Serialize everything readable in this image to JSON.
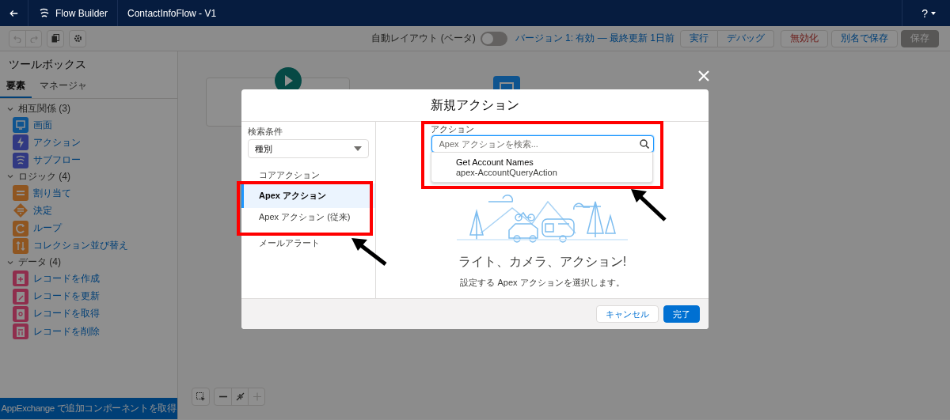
{
  "header": {
    "app_name": "Flow Builder",
    "flow_name": "ContactInfoFlow - V1",
    "help": "?"
  },
  "toolbar": {
    "auto_layout": {
      "label": "自動レイアウト (ベータ)",
      "on": false
    },
    "version": "バージョン 1: 有効 — 最終更新 1日前",
    "buttons": [
      {
        "label": "実行",
        "kind": "normal",
        "group": true,
        "disabled": false
      },
      {
        "label": "デバッグ",
        "kind": "normal",
        "group": true,
        "disabled": false
      },
      {
        "label": "無効化",
        "kind": "danger",
        "group": false,
        "disabled": false
      },
      {
        "label": "別名で保存",
        "kind": "normal",
        "group": false,
        "disabled": false
      },
      {
        "label": "保存",
        "kind": "normal",
        "group": false,
        "disabled": true
      }
    ]
  },
  "sidebar": {
    "title": "ツールボックス",
    "tabs": [
      {
        "label": "要素",
        "selected": true
      },
      {
        "label": "マネージャ",
        "selected": false
      }
    ],
    "sections": [
      {
        "label": "相互関係 (3)",
        "expanded": true,
        "items": [
          {
            "label": "画面",
            "kind": "screen"
          },
          {
            "label": "アクション",
            "kind": "action"
          },
          {
            "label": "サブフロー",
            "kind": "subflow"
          }
        ]
      },
      {
        "label": "ロジック (4)",
        "expanded": true,
        "items": [
          {
            "label": "割り当て",
            "kind": "assignment"
          },
          {
            "label": "決定",
            "kind": "decision"
          },
          {
            "label": "ループ",
            "kind": "loop"
          },
          {
            "label": "コレクション並び替え",
            "kind": "sort"
          }
        ]
      },
      {
        "label": "データ (4)",
        "expanded": true,
        "items": [
          {
            "label": "レコードを作成",
            "kind": "create"
          },
          {
            "label": "レコードを更新",
            "kind": "update"
          },
          {
            "label": "レコードを取得",
            "kind": "get"
          },
          {
            "label": "レコードを削除",
            "kind": "delete"
          }
        ]
      }
    ],
    "footer": "AppExchange で追加コンポーネントを取得"
  },
  "modal": {
    "title": "新規アクション",
    "filter_label": "検索条件",
    "filter_value": "種別",
    "categories": [
      {
        "label": "コアアクション",
        "selected": false
      },
      {
        "label": "Apex アクション",
        "selected": true
      },
      {
        "label": "Apex アクション (従来)",
        "selected": false
      },
      {
        "label": "メールアラート",
        "selected": false
      }
    ],
    "search_label": "アクション",
    "search": {
      "placeholder": "Apex アクションを検索..."
    },
    "results": [
      {
        "title": "Get Account Names",
        "subtitle": "apex-AccountQueryAction"
      }
    ],
    "empty_title": "ライト、カメラ、アクション!",
    "empty_text": "設定する Apex アクションを選択します。",
    "cancel": "キャンセル",
    "done": "完了"
  }
}
